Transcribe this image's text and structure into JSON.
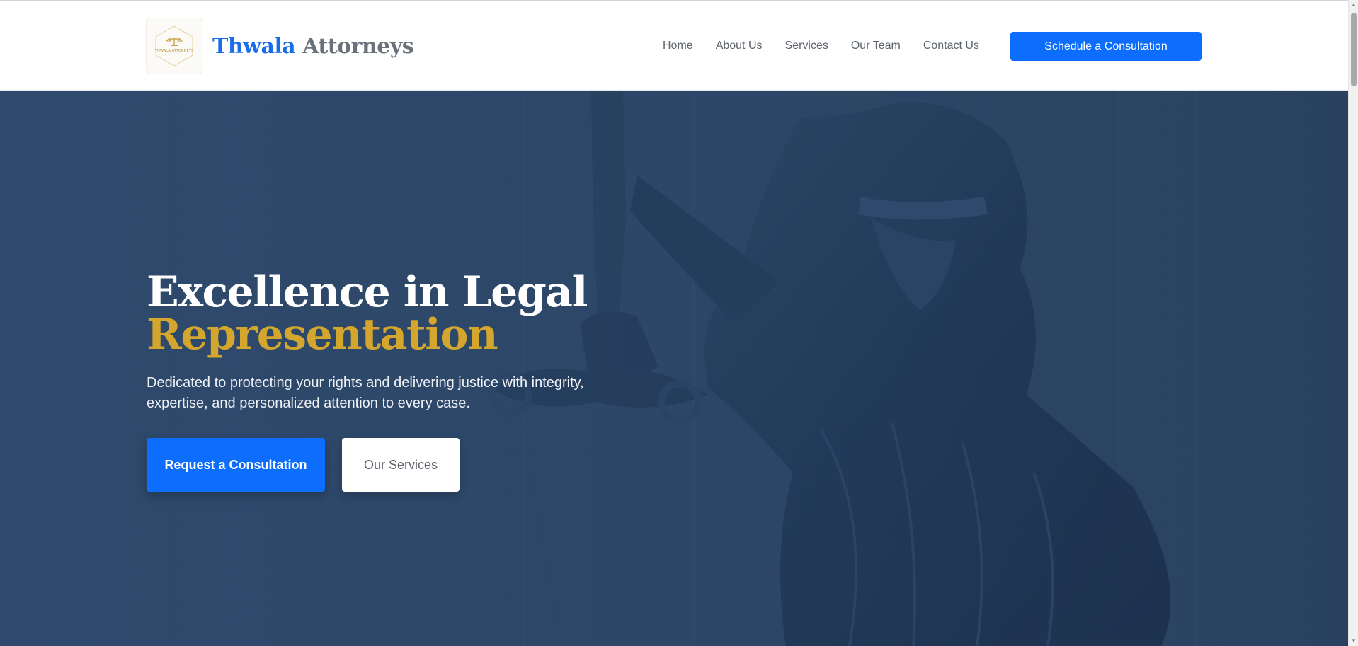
{
  "brand": {
    "logo_text": "THWALA ATTORNEYS",
    "name_first": "Thwala",
    "name_last": "Attorneys"
  },
  "nav": {
    "items": [
      {
        "label": "Home",
        "active": true
      },
      {
        "label": "About Us",
        "active": false
      },
      {
        "label": "Services",
        "active": false
      },
      {
        "label": "Our Team",
        "active": false
      },
      {
        "label": "Contact Us",
        "active": false
      }
    ],
    "cta_label": "Schedule a Consultation"
  },
  "hero": {
    "title_line1": "Excellence in Legal",
    "title_line2": "Representation",
    "subtitle": "Dedicated to protecting your rights and delivering justice with integrity, expertise, and personalized attention to every case.",
    "primary_button": "Request a Consultation",
    "secondary_button": "Our Services",
    "background_image": "lady-justice-statue-with-scales"
  },
  "colors": {
    "primary": "#0d6efd",
    "brand_blue": "#1a6dea",
    "gold_accent": "#d4a62e",
    "hero_overlay": "#2e4868",
    "nav_text": "#5d636c"
  }
}
